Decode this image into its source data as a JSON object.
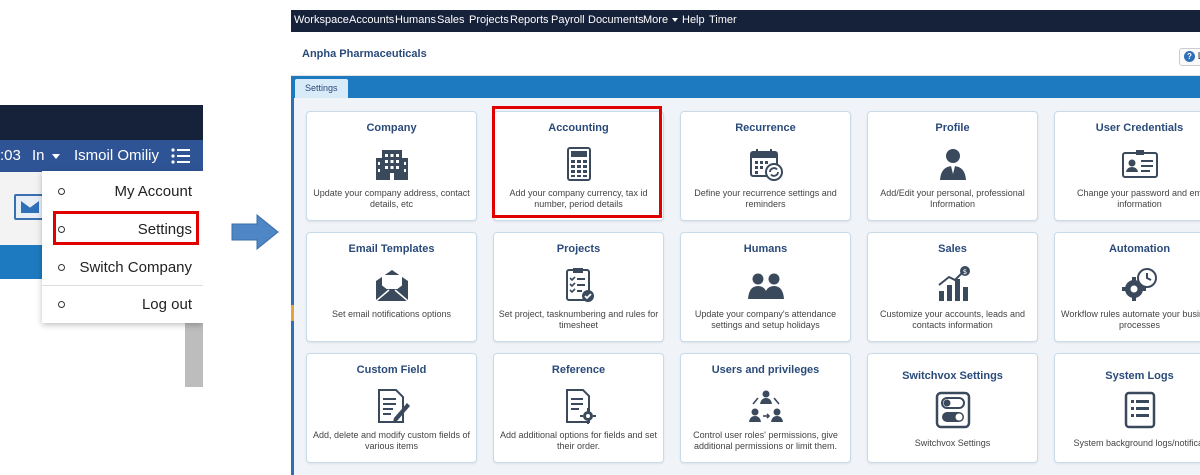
{
  "user_menu": {
    "time_fragment": ":03",
    "status_label": "In",
    "user_name": "Ismoil Omiliy",
    "items": [
      {
        "label": "My Account"
      },
      {
        "label": "Settings"
      },
      {
        "label": "Switch Company"
      },
      {
        "label": "Log out"
      }
    ]
  },
  "top_nav": {
    "items": [
      "Workspace",
      "Accounts",
      "Humans",
      "Sales",
      "Projects",
      "Reports",
      "Payroll",
      "Documents",
      "More",
      "Help",
      "Timer"
    ]
  },
  "header": {
    "company_name": "Anpha Pharmaceuticals",
    "help_label": "L"
  },
  "tabs": {
    "active": "Settings"
  },
  "tiles": [
    {
      "title": "Company",
      "icon": "building-icon",
      "desc": "Update your company address, contact details, etc"
    },
    {
      "title": "Accounting",
      "icon": "calculator-icon",
      "desc": "Add your company currency, tax id number, period details"
    },
    {
      "title": "Recurrence",
      "icon": "calendar-recurrence-icon",
      "desc": "Define your recurrence settings and reminders"
    },
    {
      "title": "Profile",
      "icon": "user-profile-icon",
      "desc": "Add/Edit your personal, professional Information"
    },
    {
      "title": "User Credentials",
      "icon": "id-card-icon",
      "desc": "Change your password and em information"
    },
    {
      "title": "Email Templates",
      "icon": "envelope-icon",
      "desc": "Set email notifications options"
    },
    {
      "title": "Projects",
      "icon": "clipboard-check-icon",
      "desc": "Set project, tasknumbering and rules for timesheet"
    },
    {
      "title": "Humans",
      "icon": "people-icon",
      "desc": "Update your company's attendance settings and setup holidays"
    },
    {
      "title": "Sales",
      "icon": "sales-chart-icon",
      "desc": "Customize your accounts, leads and contacts information"
    },
    {
      "title": "Automation",
      "icon": "automation-gear-icon",
      "desc": "Workflow rules automate your business processes"
    },
    {
      "title": "Custom Field",
      "icon": "edit-document-icon",
      "desc": "Add, delete and modify custom fields of various items"
    },
    {
      "title": "Reference",
      "icon": "document-settings-icon",
      "desc": "Add additional options for fields and set their order."
    },
    {
      "title": "Users and privileges",
      "icon": "user-hierarchy-icon",
      "desc": "Control user roles' permissions, give additional permissions or limit them."
    },
    {
      "title": "Switchvox Settings",
      "icon": "toggle-switch-icon",
      "desc": "Switchvox Settings"
    },
    {
      "title": "System Logs",
      "icon": "list-document-icon",
      "desc": "System background logs/notificat"
    }
  ],
  "colors": {
    "top_bar": "#16213a",
    "accent_blue": "#1e7ac0",
    "title_blue": "#2a4a7a",
    "highlight_red": "#e00000",
    "icon_dark": "#3a4a5c"
  }
}
